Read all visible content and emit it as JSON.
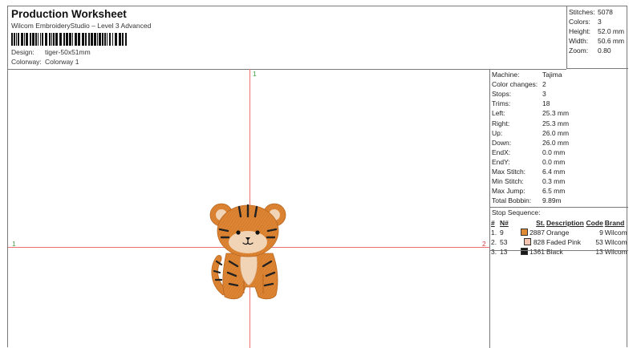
{
  "header": {
    "title": "Production Worksheet",
    "subtitle": "Wilcom EmbroideryStudio – Level 3 Advanced",
    "design_label": "Design:",
    "design_value": "tiger-50x51mm",
    "colorway_label": "Colorway:",
    "colorway_value": "Colorway 1"
  },
  "summary": {
    "stitches_label": "Stitches:",
    "stitches_value": "5078",
    "colors_label": "Colors:",
    "colors_value": "3",
    "height_label": "Height:",
    "height_value": "52.0 mm",
    "width_label": "Width:",
    "width_value": "50.6 mm",
    "zoom_label": "Zoom:",
    "zoom_value": "0.80"
  },
  "canvas": {
    "marker_top": "1",
    "marker_left": "1",
    "marker_right": "2"
  },
  "details": [
    {
      "label": "Machine:",
      "value": "Tajima"
    },
    {
      "label": "Color changes:",
      "value": "2"
    },
    {
      "label": "Stops:",
      "value": "3"
    },
    {
      "label": "Trims:",
      "value": "18"
    },
    {
      "label": "Left:",
      "value": "25.3 mm"
    },
    {
      "label": "Right:",
      "value": "25.3 mm"
    },
    {
      "label": "Up:",
      "value": "26.0 mm"
    },
    {
      "label": "Down:",
      "value": "26.0 mm"
    },
    {
      "label": "EndX:",
      "value": "0.0 mm"
    },
    {
      "label": "EndY:",
      "value": "0.0 mm"
    },
    {
      "label": "Max Stitch:",
      "value": "6.4 mm"
    },
    {
      "label": "Min Stitch:",
      "value": "0.3 mm"
    },
    {
      "label": "Max Jump:",
      "value": "6.5 mm"
    },
    {
      "label": "Total Bobbin:",
      "value": "9.89m"
    }
  ],
  "stop_sequence": {
    "title": "Stop Sequence:",
    "headers": {
      "num": "#",
      "n": "N#",
      "st": "St.",
      "desc": "Description",
      "code": "Code",
      "brand": "Brand"
    },
    "rows": [
      {
        "num": "1.",
        "n": "9",
        "color": "#e08a33",
        "st": "2887",
        "desc": "Orange",
        "code": "9",
        "brand": "Wilcom"
      },
      {
        "num": "2.",
        "n": "53",
        "color": "#f4c4b0",
        "st": "828",
        "desc": "Faded Pink",
        "code": "53",
        "brand": "Wilcom"
      },
      {
        "num": "3.",
        "n": "13",
        "color": "#1a1a1a",
        "st": "1361",
        "desc": "Black",
        "code": "13",
        "brand": "Wilcom"
      }
    ]
  }
}
